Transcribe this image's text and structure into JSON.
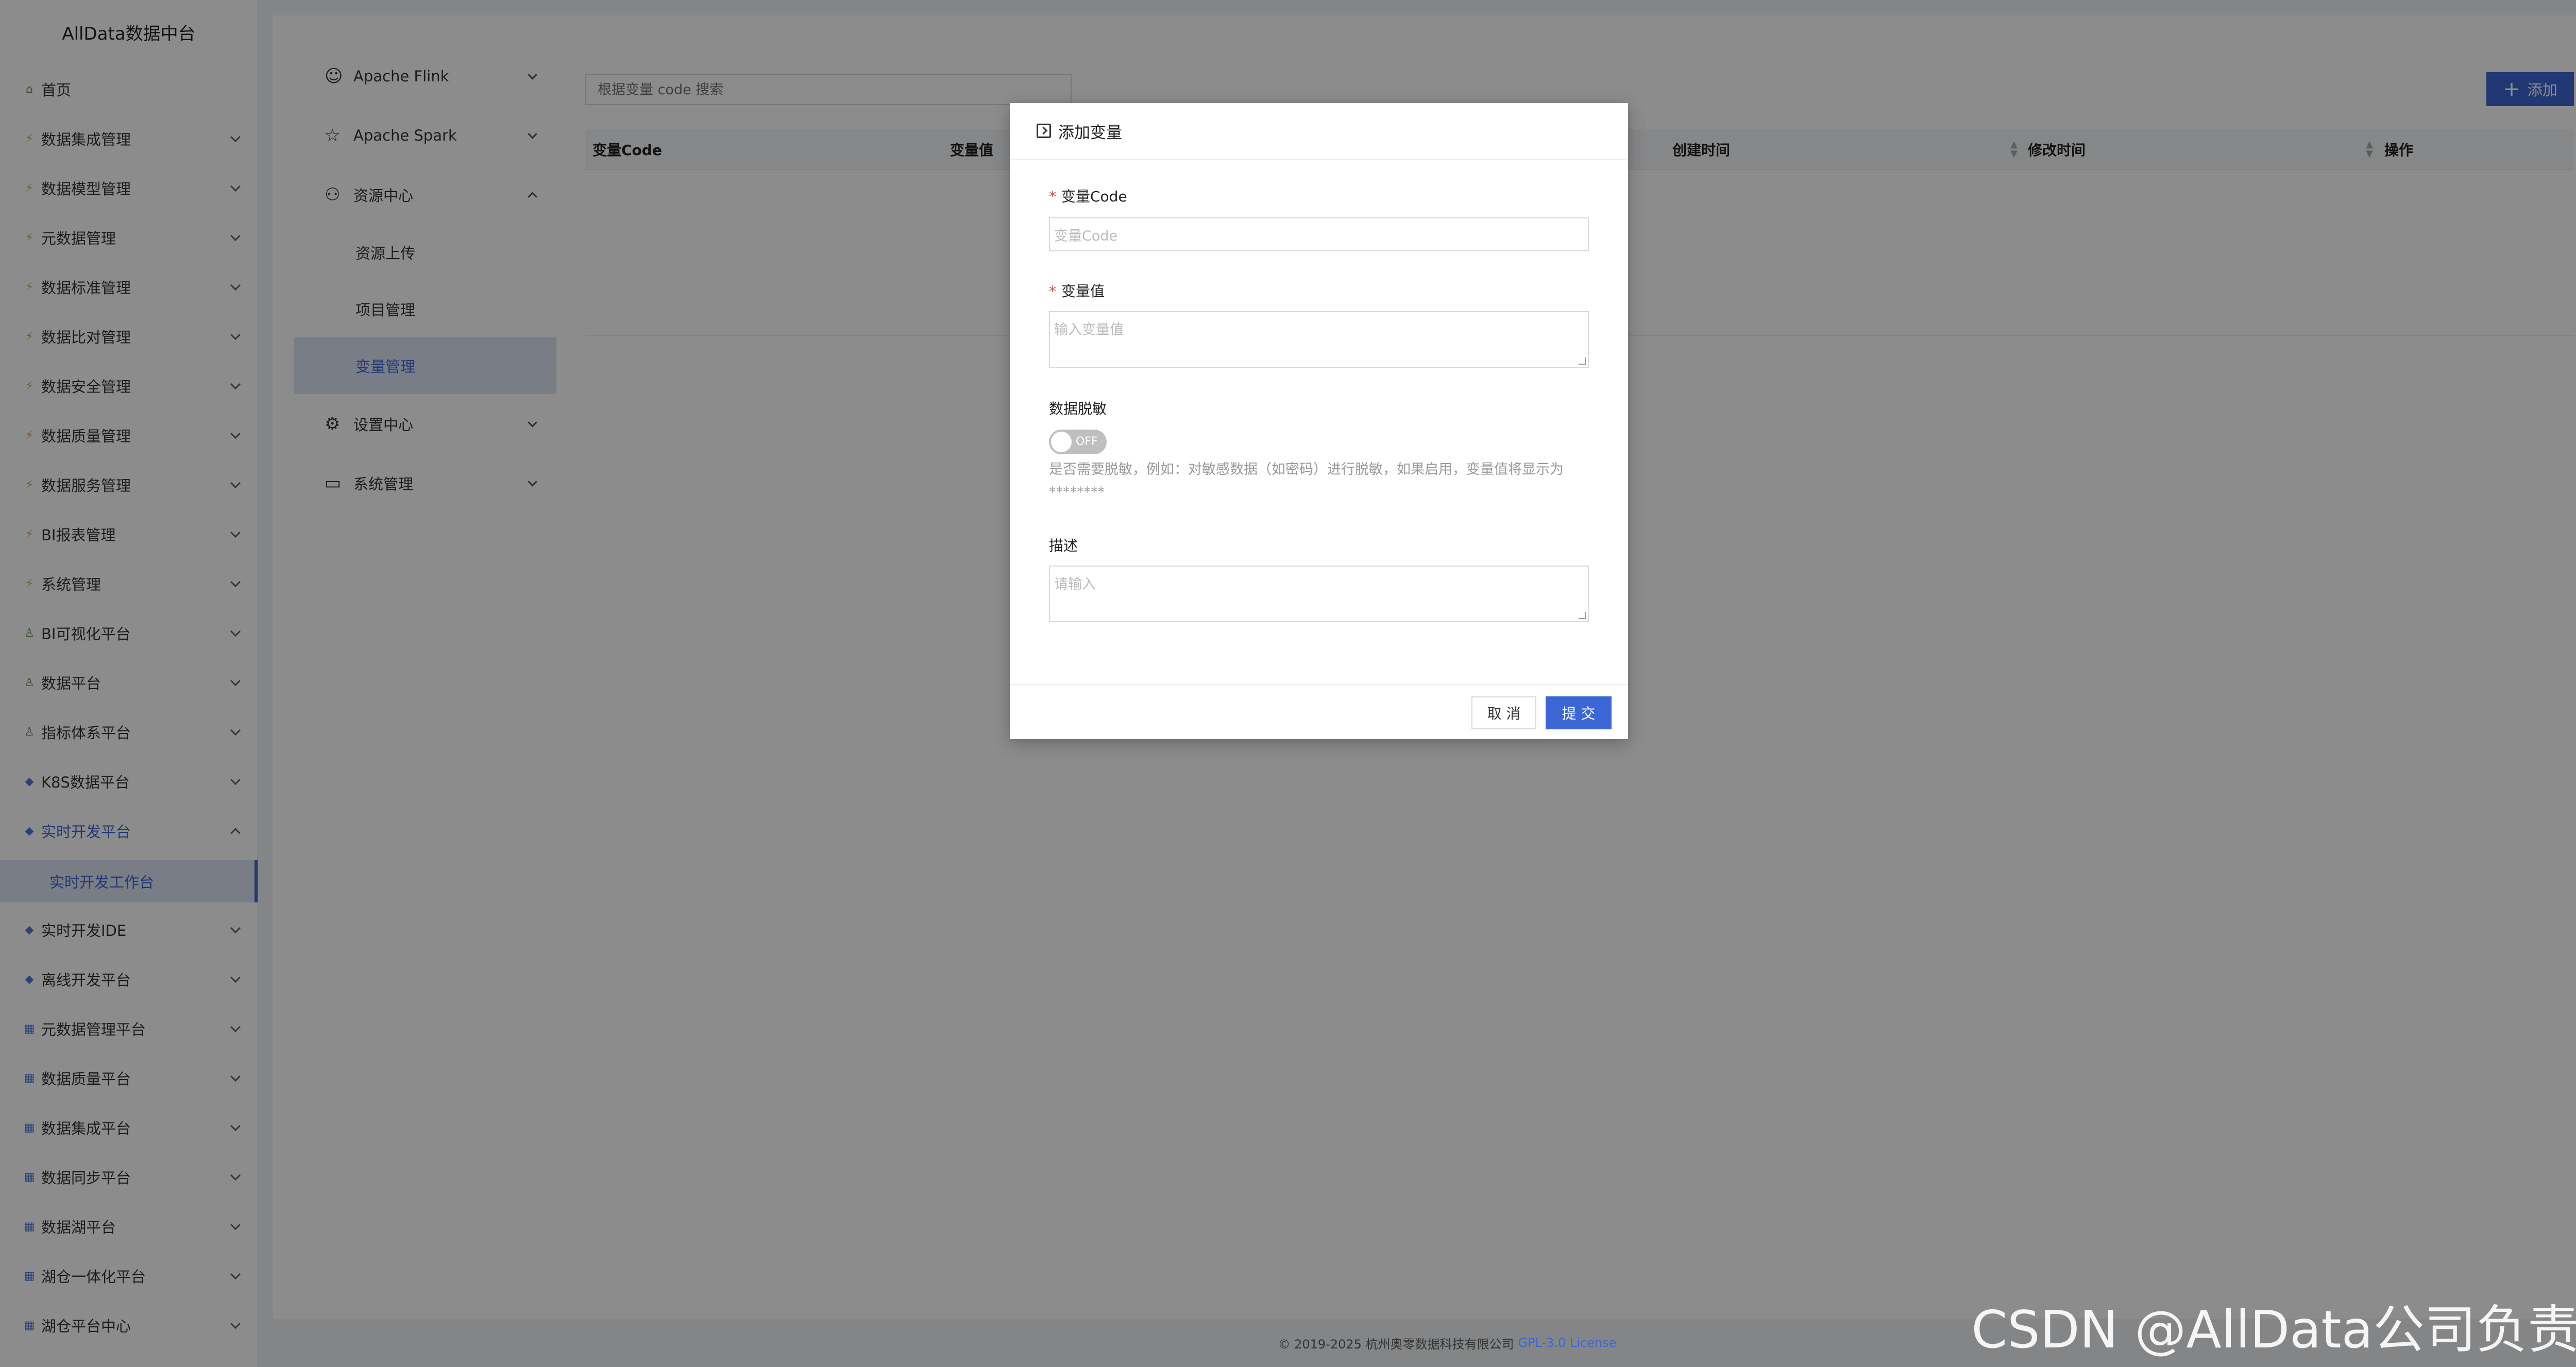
{
  "app_title": "AllData数据中台",
  "sidebar": {
    "items": [
      {
        "label": "首页",
        "icon": "home-icon",
        "expandable": false
      },
      {
        "label": "数据集成管理",
        "icon": "lightning-icon",
        "expandable": true
      },
      {
        "label": "数据模型管理",
        "icon": "lightning-icon",
        "expandable": true
      },
      {
        "label": "元数据管理",
        "icon": "lightning-icon",
        "expandable": true
      },
      {
        "label": "数据标准管理",
        "icon": "lightning-icon",
        "expandable": true
      },
      {
        "label": "数据比对管理",
        "icon": "lightning-icon",
        "expandable": true
      },
      {
        "label": "数据安全管理",
        "icon": "lightning-icon",
        "expandable": true
      },
      {
        "label": "数据质量管理",
        "icon": "lightning-icon",
        "expandable": true
      },
      {
        "label": "数据服务管理",
        "icon": "lightning-icon",
        "expandable": true
      },
      {
        "label": "BI报表管理",
        "icon": "lightning-icon",
        "expandable": true
      },
      {
        "label": "系统管理",
        "icon": "lightning-icon",
        "expandable": true
      },
      {
        "label": "BI可视化平台",
        "icon": "person-icon",
        "expandable": true
      },
      {
        "label": "数据平台",
        "icon": "person-icon",
        "expandable": true
      },
      {
        "label": "指标体系平台",
        "icon": "person-icon",
        "expandable": true
      },
      {
        "label": "K8S数据平台",
        "icon": "diamond-icon",
        "expandable": true
      },
      {
        "label": "实时开发平台",
        "icon": "diamond-icon",
        "expandable": true,
        "open": true
      },
      {
        "label": "实时开发IDE",
        "icon": "diamond-icon",
        "expandable": true
      },
      {
        "label": "离线开发平台",
        "icon": "diamond-icon",
        "expandable": true
      },
      {
        "label": "元数据管理平台",
        "icon": "grid-icon",
        "expandable": true
      },
      {
        "label": "数据质量平台",
        "icon": "grid-icon",
        "expandable": true
      },
      {
        "label": "数据集成平台",
        "icon": "grid-icon",
        "expandable": true
      },
      {
        "label": "数据同步平台",
        "icon": "grid-icon",
        "expandable": true
      },
      {
        "label": "数据湖平台",
        "icon": "grid-icon",
        "expandable": true
      },
      {
        "label": "湖仓一体化平台",
        "icon": "grid-icon",
        "expandable": true
      },
      {
        "label": "湖仓平台中心",
        "icon": "grid-icon",
        "expandable": true
      }
    ],
    "active_child": "实时开发工作台"
  },
  "submenu": {
    "items": [
      {
        "label": "Apache Flink",
        "icon": "squirrel-icon"
      },
      {
        "label": "Apache Spark",
        "icon": "star-icon"
      },
      {
        "label": "资源中心",
        "icon": "cluster-icon"
      },
      {
        "label": "设置中心",
        "icon": "gear-icon"
      },
      {
        "label": "系统管理",
        "icon": "monitor-icon"
      }
    ],
    "children": [
      "资源上传",
      "项目管理",
      "变量管理"
    ],
    "active_child": "变量管理"
  },
  "search": {
    "placeholder": "根据变量 code 搜索"
  },
  "add_button": "添加",
  "table": {
    "columns": [
      "变量Code",
      "变量值",
      "创建时间",
      "修改时间",
      "操作"
    ]
  },
  "modal": {
    "title": "添加变量",
    "fields": {
      "code_label": "变量Code",
      "code_placeholder": "变量Code",
      "value_label": "变量值",
      "value_placeholder": "输入变量值",
      "mask_label": "数据脱敏",
      "mask_switch_text": "OFF",
      "mask_hint": "是否需要脱敏，例如：对敏感数据（如密码）进行脱敏，如果启用，变量值将显示为********",
      "desc_label": "描述",
      "desc_placeholder": "请输入"
    },
    "cancel_label": "取 消",
    "submit_label": "提 交"
  },
  "footer": {
    "copyright": "© 2019-2025 杭州奥零数据科技有限公司",
    "license": "GPL-3.0 License"
  },
  "watermark": "CSDN @AllData公司负责人",
  "colors": {
    "accent": "#3c66d6",
    "required": "#e04545"
  }
}
